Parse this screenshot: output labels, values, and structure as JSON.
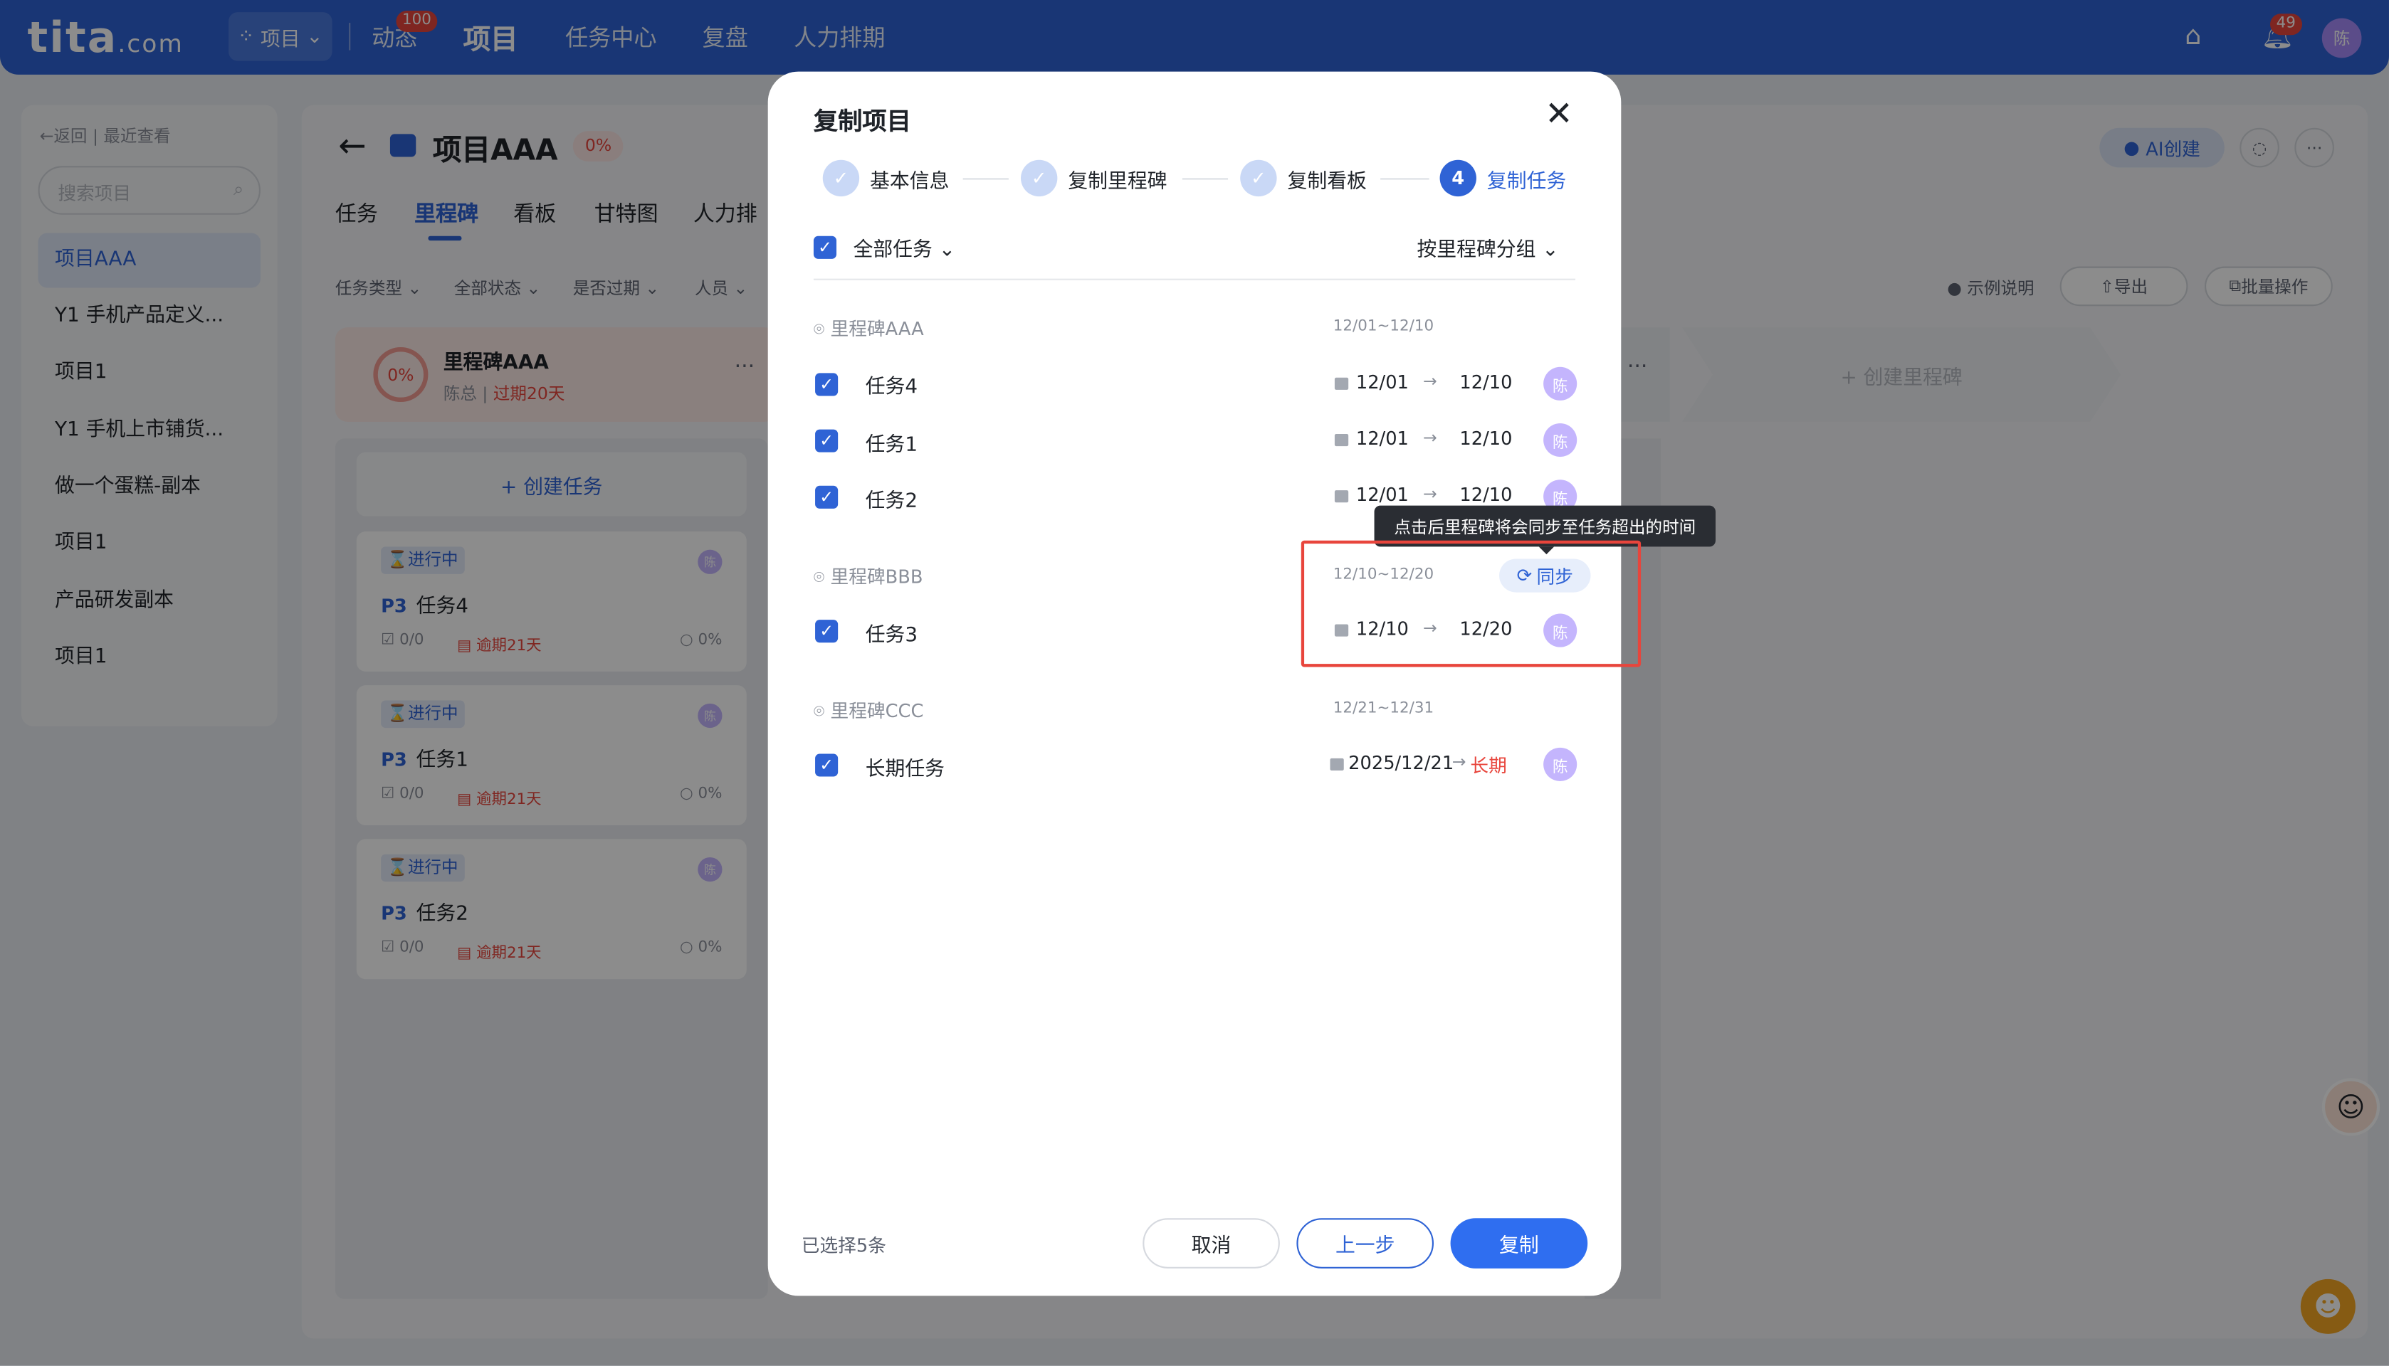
{
  "header": {
    "logo": "tita",
    "logo_suffix": ".com",
    "project_switch": "项目",
    "nav": [
      "动态",
      "项目",
      "任务中心",
      "复盘",
      "人力排期"
    ],
    "dynamic_badge": "100",
    "bell_badge": "49",
    "avatar": "陈"
  },
  "sidebar": {
    "back": "返回",
    "recent": "最近查看",
    "search_placeholder": "搜索项目",
    "items": [
      "项目AAA",
      "Y1 手机产品定义...",
      "项目1",
      "Y1 手机上市铺货...",
      "做一个蛋糕-副本",
      "项目1",
      "产品研发副本",
      "项目1"
    ]
  },
  "main": {
    "title": "项目AAA",
    "progress": "0%",
    "tabs": [
      "任务",
      "里程碑",
      "看板",
      "甘特图",
      "人力排"
    ],
    "filters": [
      "任务类型",
      "全部状态",
      "是否过期",
      "人员"
    ],
    "ai_button": "AI创建",
    "example": "示例说明",
    "export": "导出",
    "batch": "批量操作",
    "milestone_card": {
      "pct": "0%",
      "name": "里程碑AAA",
      "owner": "陈总",
      "late": "过期20天"
    },
    "create_milestone": "+ 创建里程碑",
    "create_task": "+ 创建任务",
    "task_cards": [
      {
        "status": "进行中",
        "priority": "P3",
        "name": "任务4",
        "sub": "0/0",
        "late": "逾期21天",
        "pct": "0%",
        "avatar": "陈"
      },
      {
        "status": "进行中",
        "priority": "P3",
        "name": "任务1",
        "sub": "0/0",
        "late": "逾期21天",
        "pct": "0%",
        "avatar": "陈"
      },
      {
        "status": "进行中",
        "priority": "P3",
        "name": "任务2",
        "sub": "0/0",
        "late": "逾期21天",
        "pct": "0%",
        "avatar": "陈"
      }
    ]
  },
  "modal": {
    "title": "复制项目",
    "steps": [
      {
        "label": "基本信息",
        "num": "✓"
      },
      {
        "label": "复制里程碑",
        "num": "✓"
      },
      {
        "label": "复制看板",
        "num": "✓"
      },
      {
        "label": "复制任务",
        "num": "4"
      }
    ],
    "all_tasks": "全部任务",
    "group_by": "按里程碑分组",
    "milestones": [
      {
        "name": "里程碑AAA",
        "range": "12/01~12/10",
        "tasks": [
          {
            "name": "任务4",
            "start": "12/01",
            "end": "12/10",
            "avatar": "陈"
          },
          {
            "name": "任务1",
            "start": "12/01",
            "end": "12/10",
            "avatar": "陈"
          },
          {
            "name": "任务2",
            "start": "12/01",
            "end": "12/10",
            "avatar": "陈"
          }
        ]
      },
      {
        "name": "里程碑BBB",
        "range": "12/10~12/20",
        "tasks": [
          {
            "name": "任务3",
            "start": "12/10",
            "end": "12/20",
            "avatar": "陈"
          }
        ]
      },
      {
        "name": "里程碑CCC",
        "range": "12/21~12/31",
        "tasks": [
          {
            "name": "长期任务",
            "start": "2025/12/21",
            "end": "长期",
            "avatar": "陈"
          }
        ]
      }
    ],
    "sync_button": "同步",
    "tooltip": "点击后里程碑将会同步至任务超出的时间",
    "selected": "已选择5条",
    "cancel": "取消",
    "prev": "上一步",
    "copy": "复制"
  },
  "colors": {
    "primary": "#2f63d5",
    "danger": "#e8453c",
    "overlay": "rgba(0,0,0,0.45)"
  }
}
